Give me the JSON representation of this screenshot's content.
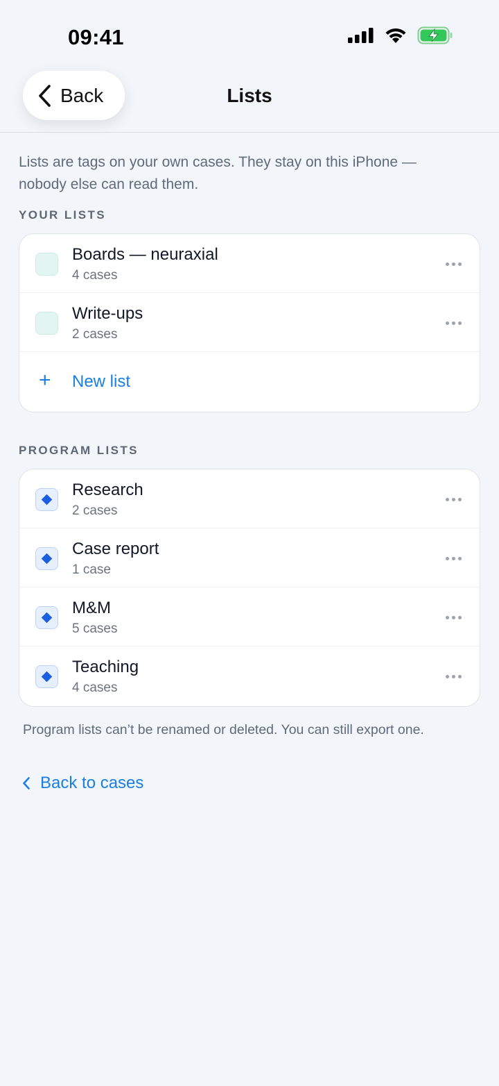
{
  "status_bar": {
    "time": "09:41"
  },
  "nav": {
    "back_label": "Back",
    "title": "Lists"
  },
  "intro": "Lists are tags on your own cases. They stay on this iPhone — nobody else can read them.",
  "your_lists": {
    "header": "YOUR LISTS",
    "items": [
      {
        "title": "Boards — neuraxial",
        "count": "4 cases"
      },
      {
        "title": "Write-ups",
        "count": "2 cases"
      }
    ],
    "new_list_label": "New list"
  },
  "program_lists": {
    "header": "PROGRAM LISTS",
    "items": [
      {
        "title": "Research",
        "count": "2 cases"
      },
      {
        "title": "Case report",
        "count": "1 case"
      },
      {
        "title": "M&M",
        "count": "5 cases"
      },
      {
        "title": "Teaching",
        "count": "4 cases"
      }
    ]
  },
  "footnote": "Program lists can’t be renamed or deleted. You can still export one.",
  "back_to_cases_label": "Back to cases",
  "colors": {
    "accent": "#1a7fe0",
    "program_marker": "#1a5fe0",
    "personal_swatch": "#e3f5f1",
    "battery": "#34c759"
  },
  "icons": {
    "status": [
      "cellular-signal-icon",
      "wifi-icon",
      "battery-charging-icon"
    ],
    "nav": "chevron-left-icon",
    "row_action": "more-dots-icon",
    "new": "plus-icon",
    "program_marker": "diamond-icon"
  }
}
